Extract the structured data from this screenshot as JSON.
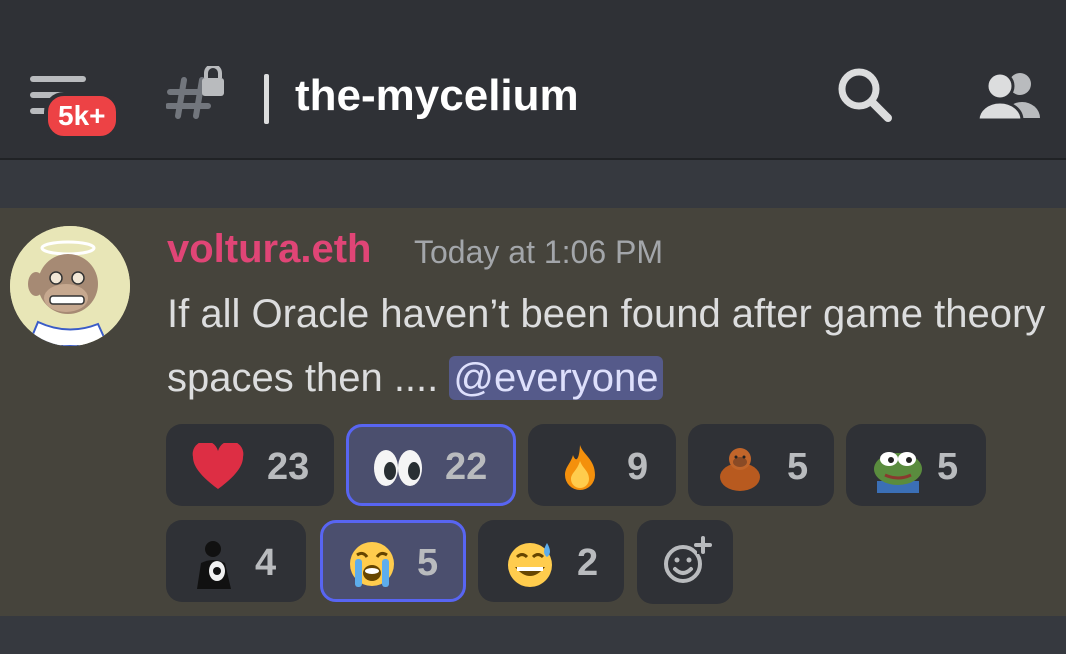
{
  "header": {
    "unread_badge": "5k+",
    "channel_name": "the-mycelium"
  },
  "message": {
    "author": "voltura.eth",
    "author_color": "#e04576",
    "timestamp": "Today at 1:06 PM",
    "text": "If all Oracle haven’t been found after game theory spaces then .... ",
    "mention": "@everyone"
  },
  "reactions": [
    {
      "emoji": "heart",
      "count": "23",
      "active": false
    },
    {
      "emoji": "eyes",
      "count": "22",
      "active": true
    },
    {
      "emoji": "fire",
      "count": "9",
      "active": false
    },
    {
      "emoji": "orangutan",
      "count": "5",
      "active": false
    },
    {
      "emoji": "pepe-frog",
      "count": "5",
      "active": false
    },
    {
      "emoji": "custom-figure",
      "count": "4",
      "active": false
    },
    {
      "emoji": "loudly-crying-face",
      "count": "5",
      "active": true
    },
    {
      "emoji": "grinning-sweat-face",
      "count": "2",
      "active": false
    }
  ],
  "accent": "#5865f2"
}
